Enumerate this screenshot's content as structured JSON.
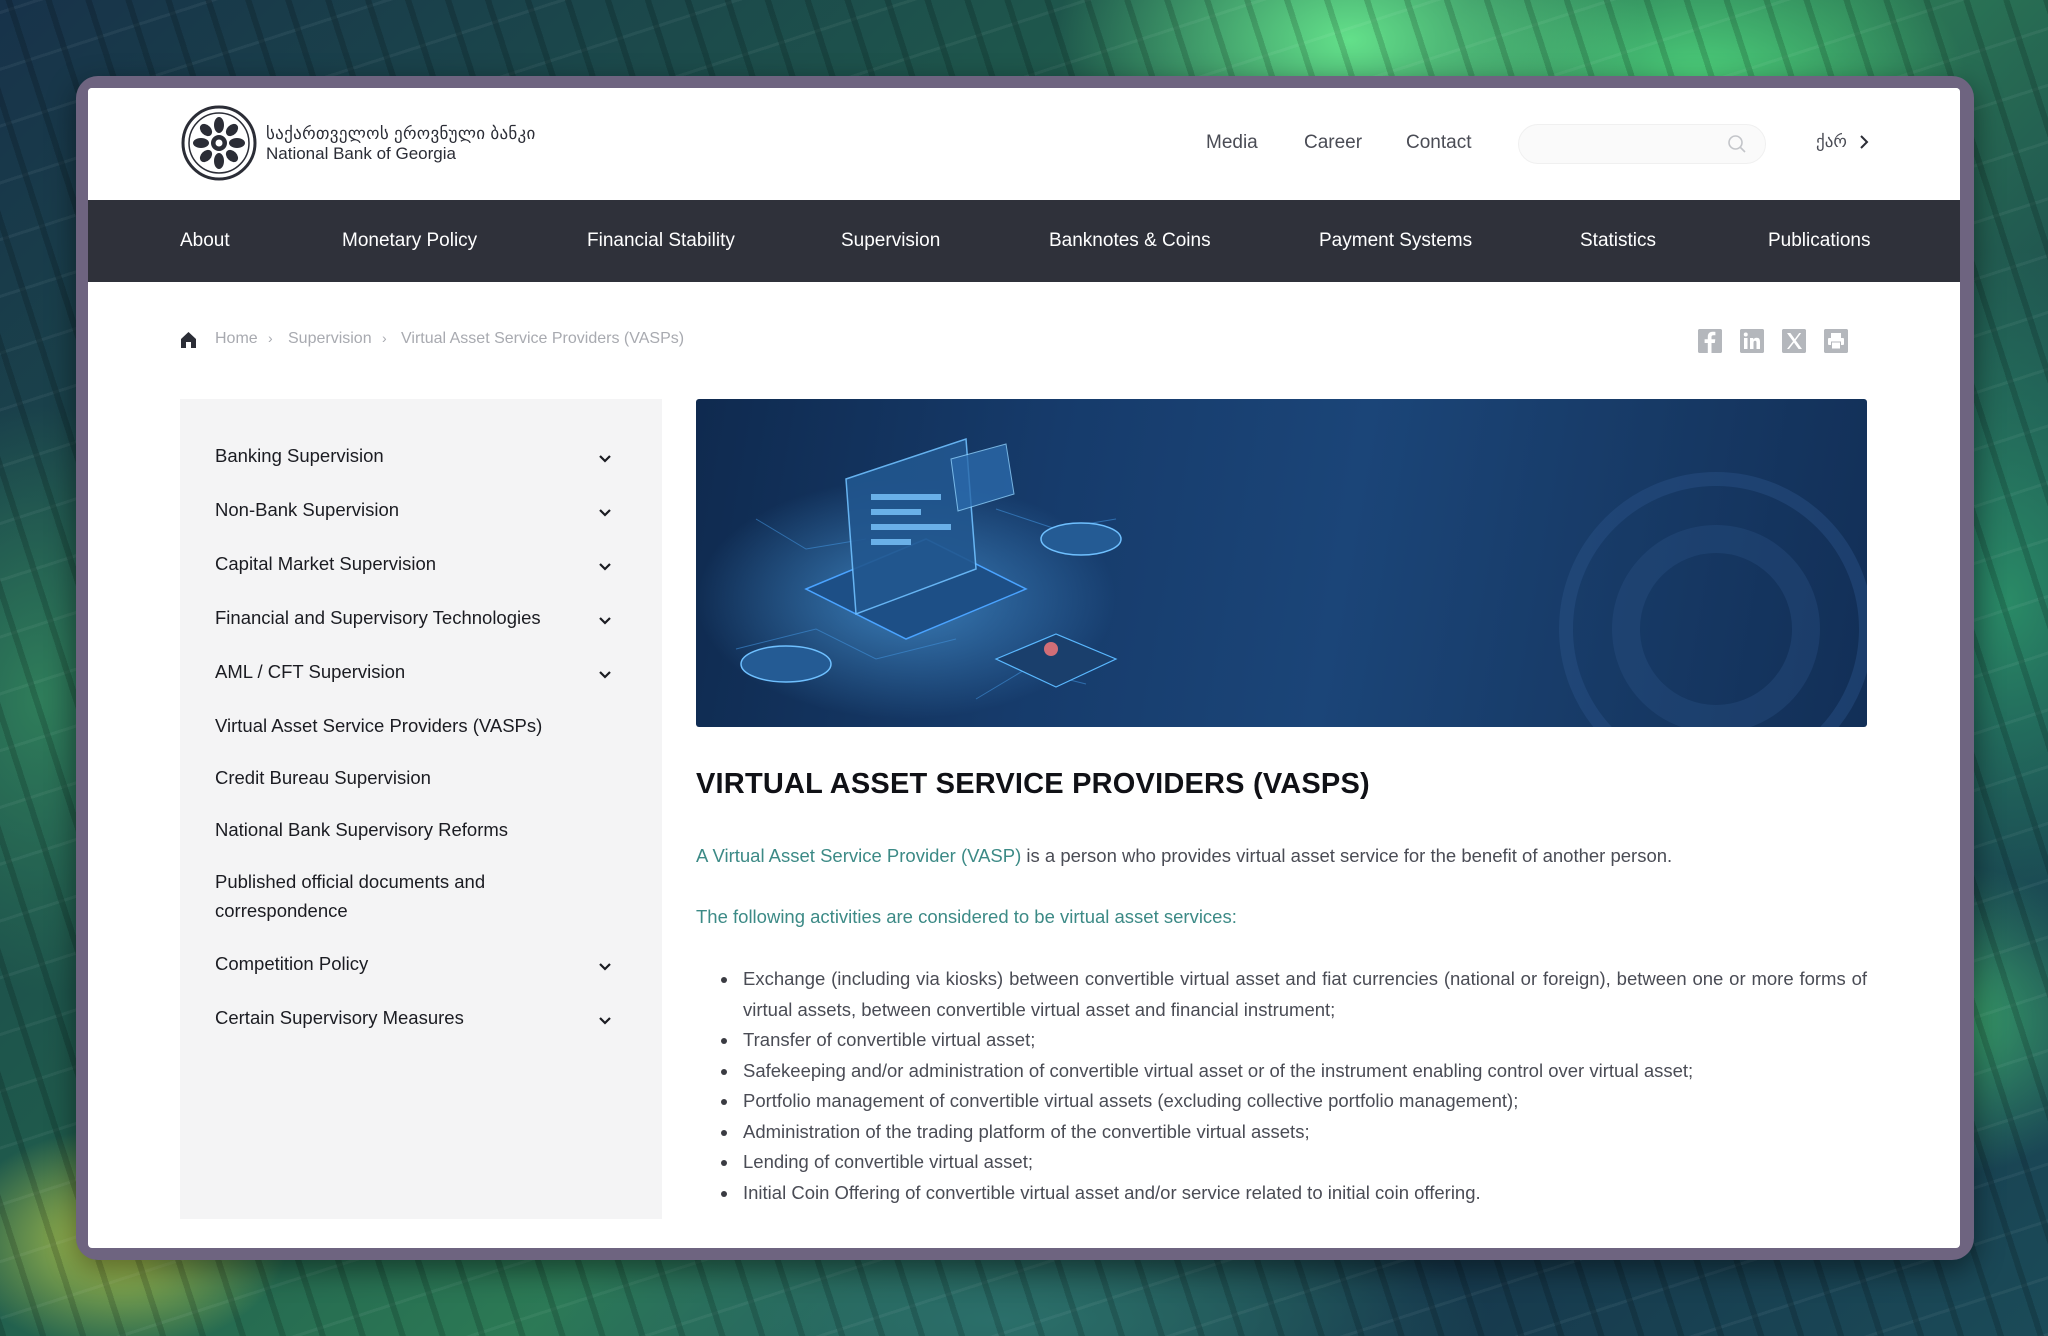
{
  "brand": {
    "name_ka": "საქართველოს ეროვნული ბანკი",
    "name_en": "National Bank of Georgia"
  },
  "top_links": [
    "Media",
    "Career",
    "Contact"
  ],
  "search": {
    "placeholder": ""
  },
  "language": {
    "label": "ქარ"
  },
  "main_nav": [
    "About",
    "Monetary Policy",
    "Financial Stability",
    "Supervision",
    "Banknotes & Coins",
    "Payment Systems",
    "Statistics",
    "Publications"
  ],
  "breadcrumb": [
    "Home",
    "Supervision",
    "Virtual Asset Service Providers (VASPs)"
  ],
  "share_icons": [
    "facebook-icon",
    "linkedin-icon",
    "x-icon",
    "print-icon"
  ],
  "sidebar": {
    "items": [
      {
        "label": "Banking Supervision",
        "expandable": true
      },
      {
        "label": "Non-Bank Supervision",
        "expandable": true
      },
      {
        "label": "Capital Market Supervision",
        "expandable": true
      },
      {
        "label": "Financial and Supervisory Technologies",
        "expandable": true
      },
      {
        "label": "AML / CFT Supervision",
        "expandable": true
      },
      {
        "label": "Virtual Asset Service Providers (VASPs)",
        "expandable": false
      },
      {
        "label": "Credit Bureau Supervision",
        "expandable": false
      },
      {
        "label": "National Bank Supervisory Reforms",
        "expandable": false
      },
      {
        "label": "Published official documents and correspondence",
        "expandable": false
      },
      {
        "label": "Competition Policy",
        "expandable": true
      },
      {
        "label": "Certain Supervisory Measures",
        "expandable": true
      }
    ]
  },
  "content": {
    "title": "VIRTUAL ASSET SERVICE PROVIDERS (VASPS)",
    "intro_link": "A Virtual Asset Service Provider (VASP)",
    "intro_rest": " is a person who provides virtual asset service for the benefit of another person.",
    "services_heading": "The following activities are considered to be virtual asset services:",
    "services": [
      "Exchange (including via kiosks) between convertible virtual asset and fiat currencies (national or foreign), between one or more forms of virtual assets, between convertible virtual asset and financial instrument;",
      "Transfer of convertible virtual asset;",
      "Safekeeping and/or administration of convertible virtual asset or of the instrument enabling control over virtual asset;",
      "Portfolio management of convertible virtual assets (excluding collective portfolio management);",
      "Administration of the trading platform of the convertible virtual assets;",
      "Lending of convertible virtual asset;",
      "Initial Coin Offering of convertible virtual asset and/or service related to initial coin offering."
    ]
  },
  "colors": {
    "nav_bg": "#2f313a",
    "accent_teal": "#3c8a86",
    "sidebar_bg": "#f4f4f5"
  }
}
